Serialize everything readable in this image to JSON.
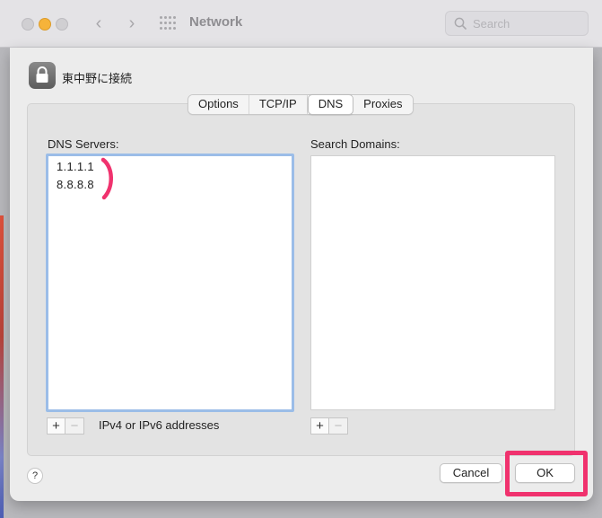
{
  "window": {
    "title": "Network",
    "search_placeholder": "Search"
  },
  "sheet": {
    "title": "東中野に接続",
    "tabs": [
      {
        "label": "Options",
        "active": false
      },
      {
        "label": "TCP/IP",
        "active": false
      },
      {
        "label": "DNS",
        "active": true
      },
      {
        "label": "Proxies",
        "active": false
      }
    ],
    "dns_servers": {
      "label": "DNS Servers:",
      "items": [
        "1.1.1.1",
        "8.8.8.8"
      ],
      "hint": "IPv4 or IPv6 addresses"
    },
    "search_domains": {
      "label": "Search Domains:",
      "items": []
    },
    "buttons": {
      "add": "+",
      "remove": "−",
      "help": "?",
      "cancel": "Cancel",
      "ok": "OK"
    }
  },
  "annotations": {
    "highlight_color": "#f0326e"
  }
}
